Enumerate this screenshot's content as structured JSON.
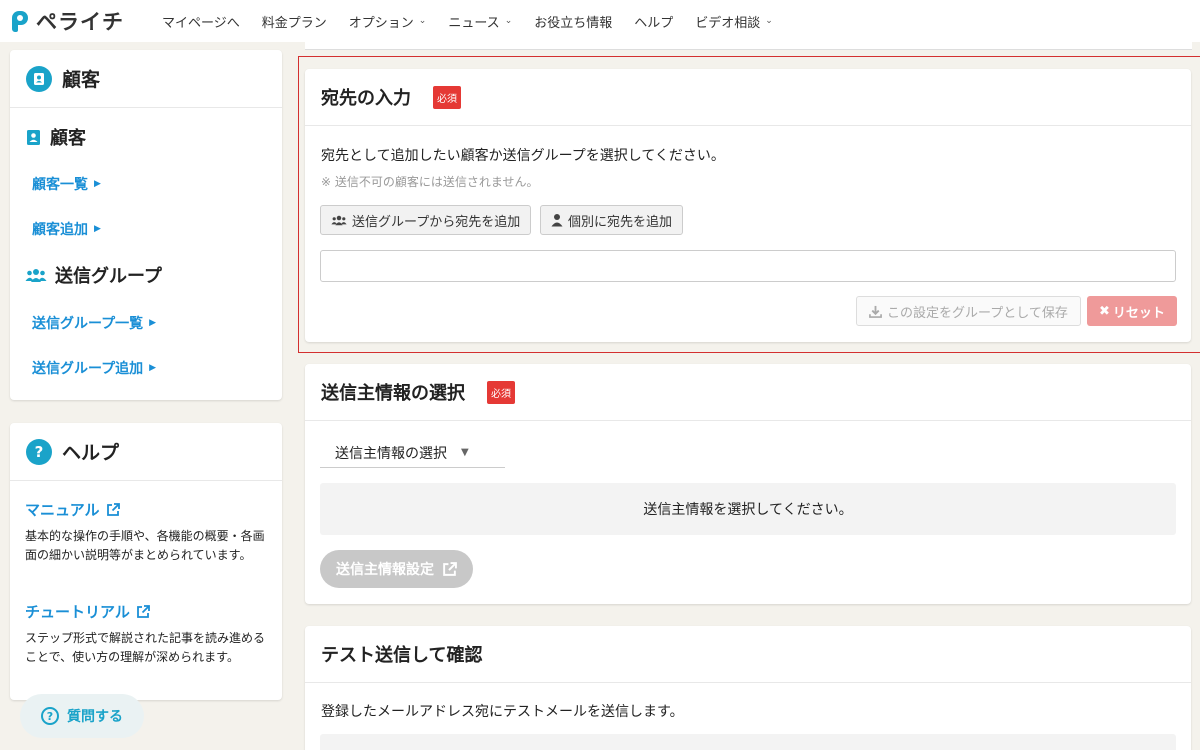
{
  "header": {
    "logo_text": "ペライチ",
    "nav": [
      {
        "label": "マイページへ",
        "has_dropdown": false
      },
      {
        "label": "料金プラン",
        "has_dropdown": false
      },
      {
        "label": "オプション",
        "has_dropdown": true
      },
      {
        "label": "ニュース",
        "has_dropdown": true
      },
      {
        "label": "お役立ち情報",
        "has_dropdown": false
      },
      {
        "label": "ヘルプ",
        "has_dropdown": false
      },
      {
        "label": "ビデオ相談",
        "has_dropdown": true
      }
    ]
  },
  "sidebar": {
    "customers_card": {
      "title": "顧客",
      "section_customers": {
        "title": "顧客",
        "links": [
          "顧客一覧",
          "顧客追加"
        ]
      },
      "section_groups": {
        "title": "送信グループ",
        "links": [
          "送信グループ一覧",
          "送信グループ追加"
        ]
      }
    },
    "help_card": {
      "title": "ヘルプ",
      "manual_label": "マニュアル",
      "manual_desc": "基本的な操作の手順や、各機能の概要・各画面の細かい説明等がまとめられています。",
      "tutorial_label": "チュートリアル",
      "tutorial_desc": "ステップ形式で解説された記事を読み進めることで、使い方の理解が深められます。"
    },
    "ask_button": "質問する"
  },
  "main": {
    "destination": {
      "title": "宛先の入力",
      "required_badge": "必須",
      "description": "宛先として追加したい顧客か送信グループを選択してください。",
      "note": "※ 送信不可の顧客には送信されません。",
      "add_group_button": "送信グループから宛先を追加",
      "add_individual_button": "個別に宛先を追加",
      "input_value": "",
      "save_group_button": "この設定をグループとして保存",
      "reset_button": "リセット"
    },
    "sender": {
      "title": "送信主情報の選択",
      "required_badge": "必須",
      "select_label": "送信主情報の選択",
      "info_message": "送信主情報を選択してください。",
      "settings_button": "送信主情報設定"
    },
    "test_send": {
      "title": "テスト送信して確認",
      "description": "登録したメールアドレス宛にテストメールを送信します。"
    }
  },
  "colors": {
    "accent": "#1aa3c9",
    "link": "#1a8fd6",
    "required": "#e53935",
    "highlight_border": "#d32f2f",
    "reset_button": "#ef9a9a",
    "background": "#f4f2ec"
  }
}
